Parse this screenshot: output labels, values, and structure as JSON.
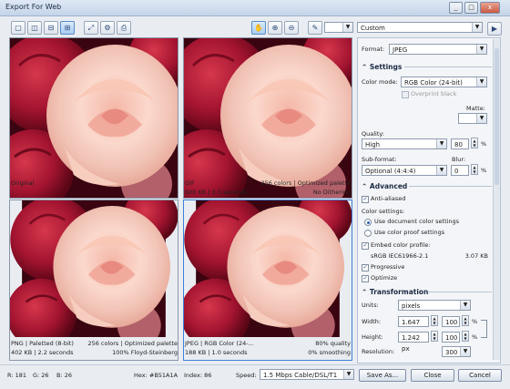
{
  "window": {
    "title": "Export For Web",
    "min_label": "_",
    "max_label": "□",
    "close_label": "x"
  },
  "toolbar": {
    "preset": "Custom",
    "play_label": "▶"
  },
  "previews": [
    {
      "left": "Original",
      "right": "",
      "left2": "",
      "right2": ""
    },
    {
      "left": "GIF",
      "right": "256 colors  |  Optimized palette",
      "left2": "600 KB  |  3.3 seconds",
      "right2": "No Dithering"
    },
    {
      "left": "PNG  |  Paletted (8-bit)",
      "right": "256 colors  |  Optimized palette",
      "left2": "402 KB  |  2.2 seconds",
      "right2": "100% Floyd-Steinberg"
    },
    {
      "left": "JPEG  |  RGB Color (24-...",
      "right": "80% quality",
      "left2": "188 KB  |  1.0 seconds",
      "right2": "0% smoothing"
    }
  ],
  "panel": {
    "format_label": "Format:",
    "format_value": "JPEG",
    "settings_title": "Settings",
    "color_mode_label": "Color mode:",
    "color_mode_value": "RGB Color (24-bit)",
    "overprint_label": "Overprint black",
    "matte_label": "Matte:",
    "quality_label": "Quality:",
    "quality_value": "High",
    "quality_num": "80",
    "quality_unit": "%",
    "subformat_label": "Sub-format:",
    "subformat_value": "Optional (4:4:4)",
    "blur_label": "Blur:",
    "blur_num": "0",
    "blur_unit": "%",
    "advanced_title": "Advanced",
    "antialiased_label": "Anti-aliased",
    "color_settings_label": "Color settings:",
    "use_doc_label": "Use document color settings",
    "use_proof_label": "Use color proof settings",
    "embed_label": "Embed color profile:",
    "profile_name": "sRGB IEC61966-2.1",
    "profile_size": "3.07 KB",
    "progressive_label": "Progressive",
    "optimize_label": "Optimize",
    "transform_title": "Transformation",
    "units_label": "Units:",
    "units_value": "pixels",
    "width_label": "Width:",
    "width_value": "1.647 px",
    "width_pct": "100",
    "height_label": "Height:",
    "height_value": "1.242 px",
    "height_pct": "100",
    "pct": "%",
    "resolution_label": "Resolution:",
    "resolution_value": "300"
  },
  "status": {
    "r": "R: 181",
    "g": "G: 26",
    "b": "B: 26",
    "hex": "Hex: #B51A1A",
    "index": "Index: 86",
    "speed_label": "Speed:",
    "speed_value": "1.5 Mbps Cable/DSL/T1",
    "save_as": "Save As...",
    "close": "Close",
    "cancel": "Cancel"
  }
}
